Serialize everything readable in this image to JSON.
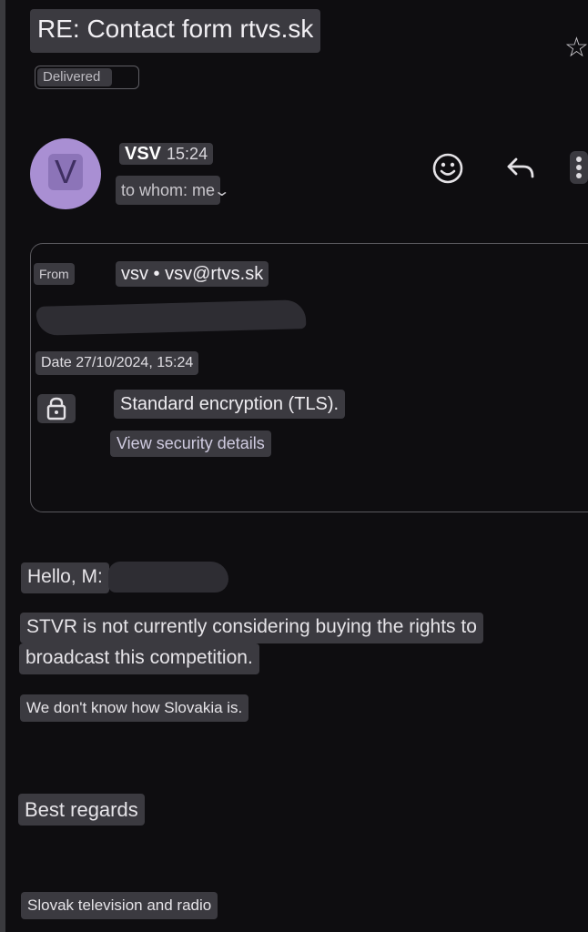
{
  "email": {
    "subject": "RE: Contact form rtvs.sk",
    "status": "Delivered",
    "avatar_letter": "V",
    "sender_name": "VSV",
    "time": "15:24",
    "to_whom": "to whom: me",
    "details": {
      "from_label": "From",
      "from_value": "vsv • vsv@rtvs.sk",
      "date": "Date 27/10/2024, 15:24",
      "encryption": "Standard encryption (TLS).",
      "security_link": "View security details"
    },
    "body": {
      "greeting": "Hello, M:",
      "line1": "STVR is not currently considering buying the rights to",
      "line2": "broadcast this competition.",
      "line3": "We don't know how Slovakia is.",
      "closing": "Best regards",
      "signature": "Slovak television and radio"
    }
  },
  "icons": [
    "star-icon",
    "emoji-icon",
    "reply-icon",
    "more-vert-icon",
    "lock-icon",
    "chevron-down-icon"
  ],
  "colors": {
    "background": "#0e0d10",
    "highlight": "#3b3a40",
    "avatar": "#a98fd3"
  }
}
